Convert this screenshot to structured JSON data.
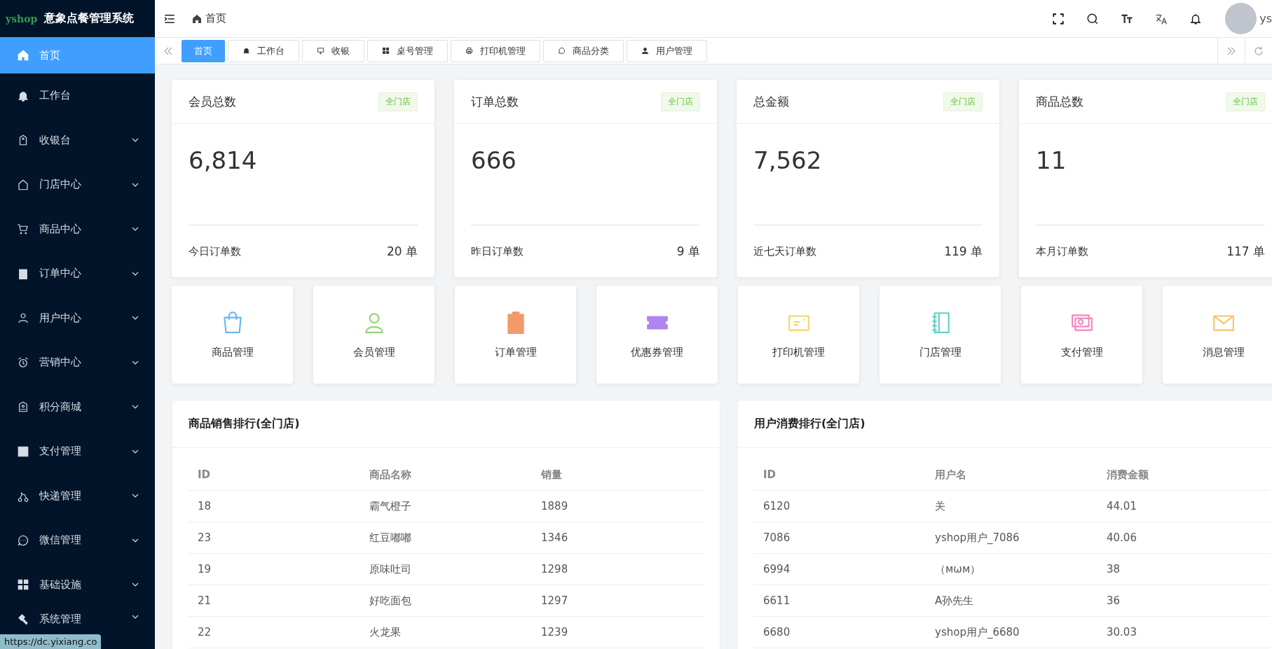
{
  "brand": {
    "logo": "yshop",
    "title": "意象点餐管理系统"
  },
  "sidebar": {
    "items": [
      {
        "label": "首页",
        "selected": true,
        "has_children": false
      },
      {
        "label": "工作台",
        "selected": false,
        "has_children": false
      },
      {
        "label": "收银台",
        "selected": false,
        "has_children": true
      },
      {
        "label": "门店中心",
        "selected": false,
        "has_children": true
      },
      {
        "label": "商品中心",
        "selected": false,
        "has_children": true
      },
      {
        "label": "订单中心",
        "selected": false,
        "has_children": true
      },
      {
        "label": "用户中心",
        "selected": false,
        "has_children": true
      },
      {
        "label": "营销中心",
        "selected": false,
        "has_children": true
      },
      {
        "label": "积分商城",
        "selected": false,
        "has_children": true
      },
      {
        "label": "支付管理",
        "selected": false,
        "has_children": true
      },
      {
        "label": "快递管理",
        "selected": false,
        "has_children": true
      },
      {
        "label": "微信管理",
        "selected": false,
        "has_children": true
      },
      {
        "label": "基础设施",
        "selected": false,
        "has_children": true
      },
      {
        "label": "系统管理",
        "selected": false,
        "has_children": true
      }
    ]
  },
  "header": {
    "breadcrumb": "首页",
    "user": "ys"
  },
  "tabs": [
    {
      "label": "首页",
      "selected": true
    },
    {
      "label": "工作台",
      "selected": false
    },
    {
      "label": "收银",
      "selected": false
    },
    {
      "label": "桌号管理",
      "selected": false
    },
    {
      "label": "打印机管理",
      "selected": false
    },
    {
      "label": "商品分类",
      "selected": false
    },
    {
      "label": "用户管理",
      "selected": false
    }
  ],
  "stats": [
    {
      "title": "会员总数",
      "tag": "全门店",
      "value": "6,814",
      "footer_label": "今日订单数",
      "footer_value": "20 单"
    },
    {
      "title": "订单总数",
      "tag": "全门店",
      "value": "666",
      "footer_label": "昨日订单数",
      "footer_value": "9 单"
    },
    {
      "title": "总金额",
      "tag": "全门店",
      "value": "7,562",
      "footer_label": "近七天订单数",
      "footer_value": "119 单"
    },
    {
      "title": "商品总数",
      "tag": "全门店",
      "value": "11",
      "footer_label": "本月订单数",
      "footer_value": "117 单"
    }
  ],
  "shortcuts": [
    {
      "label": "商品管理",
      "color": "#69b7f0"
    },
    {
      "label": "会员管理",
      "color": "#95d475"
    },
    {
      "label": "订单管理",
      "color": "#f39a6b"
    },
    {
      "label": "优惠券管理",
      "color": "#b085f0"
    },
    {
      "label": "打印机管理",
      "color": "#f5d46b"
    },
    {
      "label": "门店管理",
      "color": "#5fd0c5"
    },
    {
      "label": "支付管理",
      "color": "#f285c0"
    },
    {
      "label": "消息管理",
      "color": "#f7c36b"
    }
  ],
  "tables": [
    {
      "title": "商品销售排行(全门店)",
      "columns": [
        "ID",
        "商品名称",
        "销量"
      ],
      "rows": [
        [
          "18",
          "霸气橙子",
          "1889"
        ],
        [
          "23",
          "红豆嘟嘟",
          "1346"
        ],
        [
          "19",
          "原味吐司",
          "1298"
        ],
        [
          "21",
          "好吃面包",
          "1297"
        ],
        [
          "22",
          "火龙果",
          "1239"
        ]
      ]
    },
    {
      "title": "用户消费排行(全门店)",
      "columns": [
        "ID",
        "用户名",
        "消费金额"
      ],
      "rows": [
        [
          "6120",
          "关",
          "44.01"
        ],
        [
          "7086",
          "yshop用户_7086",
          "40.06"
        ],
        [
          "6994",
          "（мωм）",
          "38"
        ],
        [
          "6611",
          "A孙先生",
          "36"
        ],
        [
          "6680",
          "yshop用户_6680",
          "30.03"
        ]
      ]
    }
  ],
  "status_url": "https://dc.yixiang.co"
}
